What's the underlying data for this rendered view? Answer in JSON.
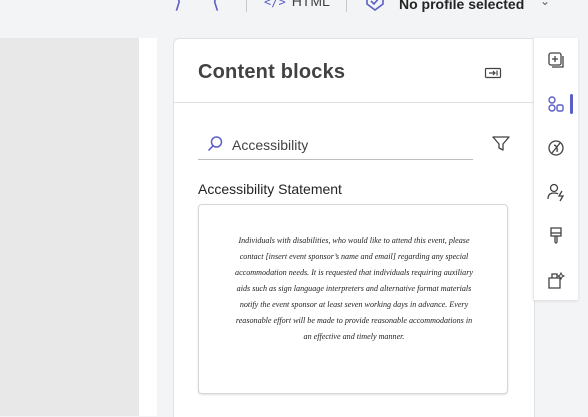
{
  "toolbar": {
    "html_label": "HTML",
    "html_code_glyph": "</>",
    "profile_text": "No profile selected",
    "chevron": "⌄"
  },
  "panel": {
    "title": "Content blocks"
  },
  "search": {
    "value": "Accessibility"
  },
  "block": {
    "label": "Accessibility Statement",
    "preview_text": "Individuals with disabilities, who would like to attend this event, please contact [insert event sponsor’s name and email] regarding any special accommodation needs. It is requested that individuals requiring auxiliary aids such as sign language interpreters and alternative format materials notify the event sponsor at least seven working days in advance. Every reasonable effort will be made to provide reasonable accommodations in an effective and timely manner."
  },
  "rail": {
    "items": [
      "add-element-icon",
      "content-blocks-icon",
      "brand-kit-icon",
      "personalization-icon",
      "styles-icon",
      "assist-icon"
    ],
    "active_index": 1
  },
  "colors": {
    "accent": "#5b5fc7",
    "canvas_gray": "#e8e8e8"
  }
}
